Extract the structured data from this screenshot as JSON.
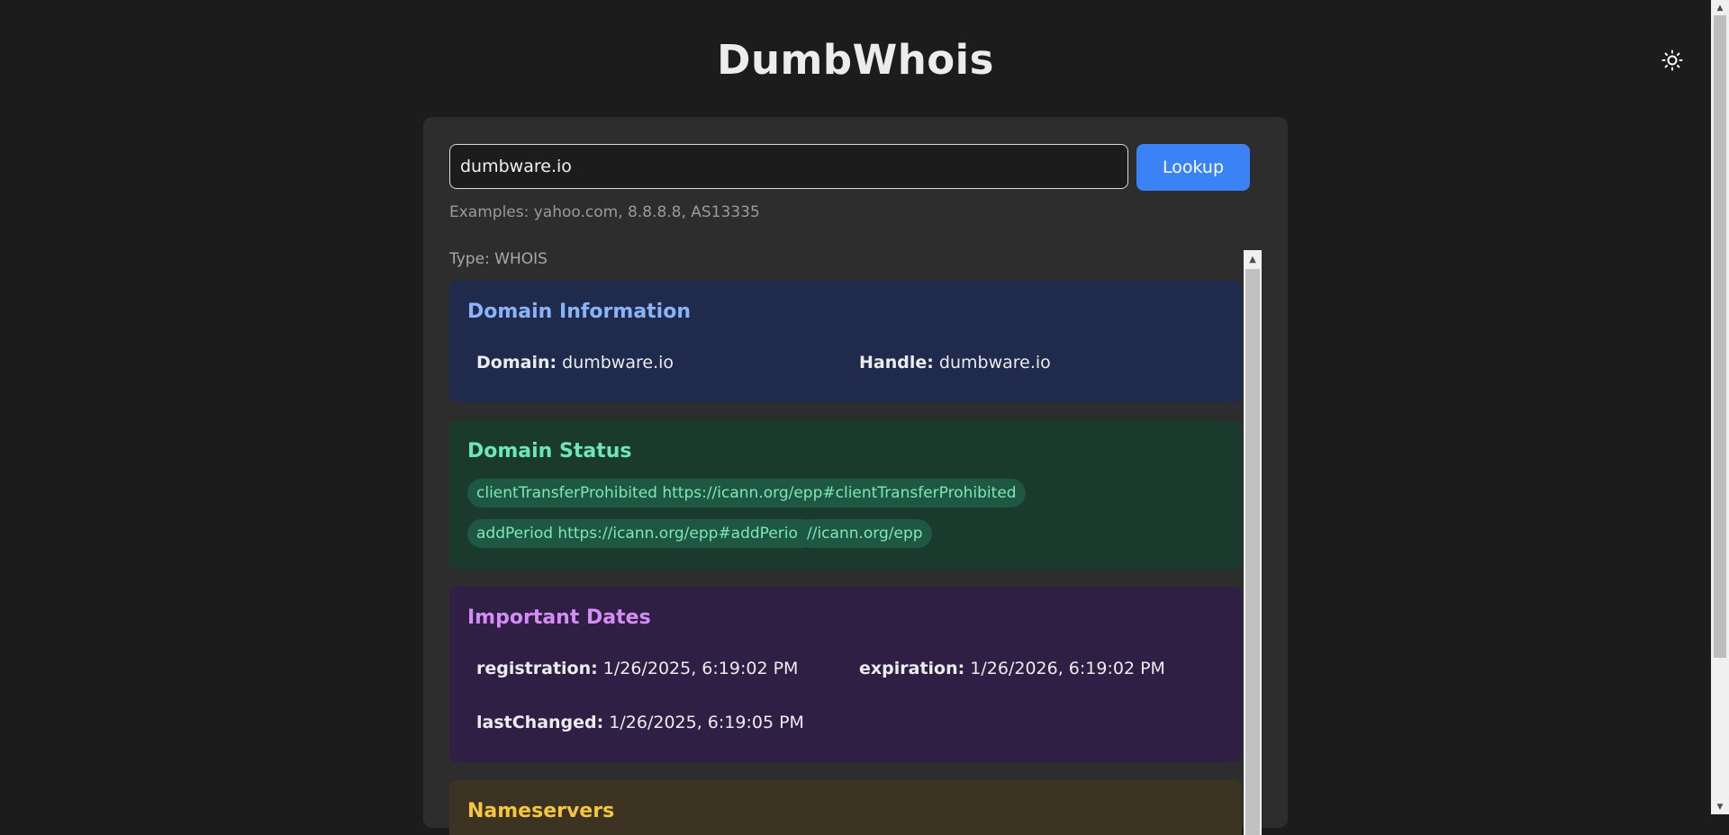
{
  "app": {
    "title": "DumbWhois"
  },
  "search": {
    "value": "dumbware.io",
    "button_label": "Lookup",
    "examples": "Examples: yahoo.com, 8.8.8.8, AS13335"
  },
  "result": {
    "type_label": "Type: WHOIS",
    "domain_info": {
      "title": "Domain Information",
      "fields": [
        {
          "label": "Domain:",
          "value": "dumbware.io"
        },
        {
          "label": "Handle:",
          "value": "dumbware.io"
        }
      ]
    },
    "domain_status": {
      "title": "Domain Status",
      "statuses": [
        "clientTransferProhibited https://icann.org/epp#clientTransferProhibited",
        "addPeriod https://icann.org/epp#addPeriod",
        "//icann.org/epp"
      ]
    },
    "important_dates": {
      "title": "Important Dates",
      "fields": [
        {
          "label": "registration:",
          "value": "1/26/2025, 6:19:02 PM"
        },
        {
          "label": "expiration:",
          "value": "1/26/2026, 6:19:02 PM"
        },
        {
          "label": "lastChanged:",
          "value": "1/26/2025, 6:19:05 PM"
        }
      ]
    },
    "nameservers": {
      "title": "Nameservers"
    }
  },
  "colors": {
    "accent": "#3b82f6",
    "domain_info_bg": "#1f2a4c",
    "domain_status_bg": "#1b3a2e",
    "important_dates_bg": "#2f1f44",
    "nameservers_bg": "#3c3322"
  },
  "icons": {
    "theme_toggle": "sun-icon"
  }
}
